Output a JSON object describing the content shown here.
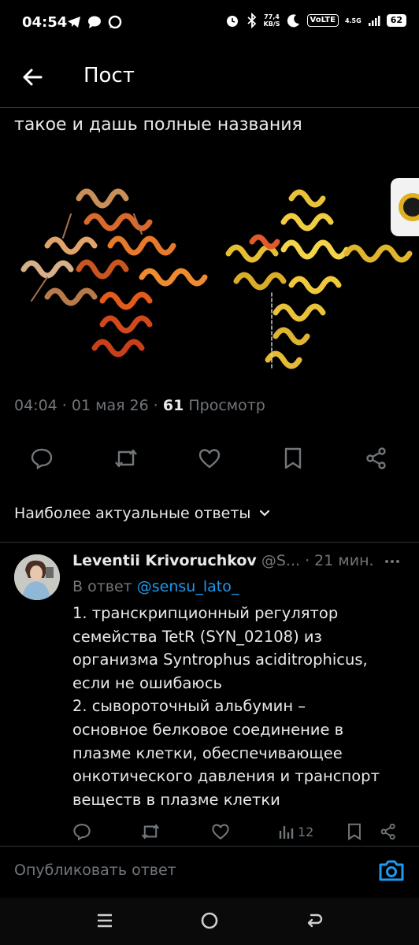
{
  "status_bar": {
    "time": "04:54",
    "net_speed_value": "77,4",
    "net_speed_unit": "KB/S",
    "volte": "VoLTE",
    "network": "4.5G",
    "battery": "62",
    "icons": [
      "telegram-icon",
      "chat-bubble-icon",
      "chat-bubble-icon",
      "alarm-icon",
      "bluetooth-icon",
      "moon-icon",
      "signal-icon"
    ]
  },
  "header": {
    "title": "Пост"
  },
  "post": {
    "text": "такое и дашь полные названия",
    "meta": {
      "time": "04:04",
      "date": "01 мая 26",
      "views_count": "61",
      "views_label": "Просмотр"
    }
  },
  "actions": [
    "reply-icon",
    "retweet-icon",
    "like-icon",
    "bookmark-icon",
    "share-icon"
  ],
  "sort": {
    "label": "Наиболее актуальные ответы"
  },
  "reply": {
    "name": "Leventii Krivoruchkov",
    "handle": "@S...",
    "time": "· 21 мин.",
    "reply_to_prefix": "В ответ",
    "reply_to_handle": "@sensu_lato_",
    "lines": [
      "1. транскрипционный регулятор",
      "семейства TetR (SYN_02108) из",
      "организма Syntrophus aciditrophicus,",
      "если не ошибаюсь",
      "2. сывороточный альбумин –",
      "основное белковое соединение в",
      "плазме клетки, обеспечивающее",
      "онкотического давления и транспорт",
      "веществ в плазме клетки"
    ],
    "views": "12"
  },
  "composer": {
    "placeholder": "Опубликовать ответ"
  },
  "colors": {
    "background": "#000000",
    "text": "#e7e9ea",
    "muted": "#71767b",
    "link": "#1d9bf0",
    "protein_left": "#d9692a",
    "protein_right": "#e8c23a"
  }
}
